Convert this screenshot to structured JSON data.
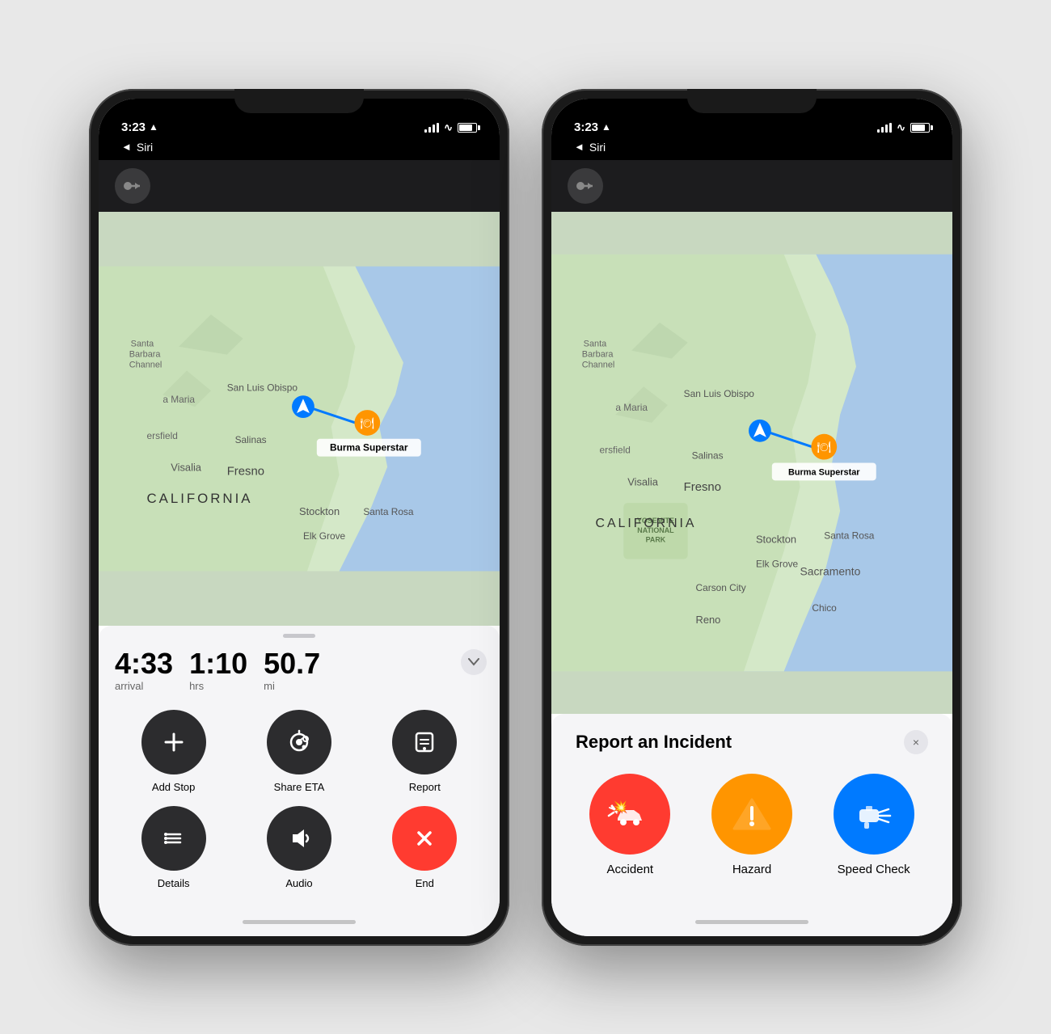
{
  "phones": [
    {
      "id": "phone-navigation",
      "status_time": "3:23",
      "siri_back": "◄ Siri",
      "nav_info": {
        "arrival": "4:33",
        "arrival_label": "arrival",
        "duration": "1:10",
        "duration_label": "hrs",
        "distance": "50.7",
        "distance_label": "mi"
      },
      "actions": [
        {
          "id": "add-stop",
          "label": "Add Stop",
          "icon": "plus",
          "variant": "dark"
        },
        {
          "id": "share-eta",
          "label": "Share ETA",
          "icon": "share-eta",
          "variant": "dark"
        },
        {
          "id": "report",
          "label": "Report",
          "icon": "report",
          "variant": "dark"
        },
        {
          "id": "details",
          "label": "Details",
          "icon": "list",
          "variant": "dark"
        },
        {
          "id": "audio",
          "label": "Audio",
          "icon": "audio",
          "variant": "dark"
        },
        {
          "id": "end",
          "label": "End",
          "icon": "x",
          "variant": "red"
        }
      ],
      "destination": "Burma Superstar"
    },
    {
      "id": "phone-incident",
      "status_time": "3:23",
      "siri_back": "◄ Siri",
      "report_panel": {
        "title": "Report an Incident",
        "close_label": "×",
        "incidents": [
          {
            "id": "accident",
            "label": "Accident",
            "color": "red"
          },
          {
            "id": "hazard",
            "label": "Hazard",
            "color": "yellow"
          },
          {
            "id": "speed-check",
            "label": "Speed Check",
            "color": "blue"
          }
        ]
      },
      "destination": "Burma Superstar"
    }
  ]
}
